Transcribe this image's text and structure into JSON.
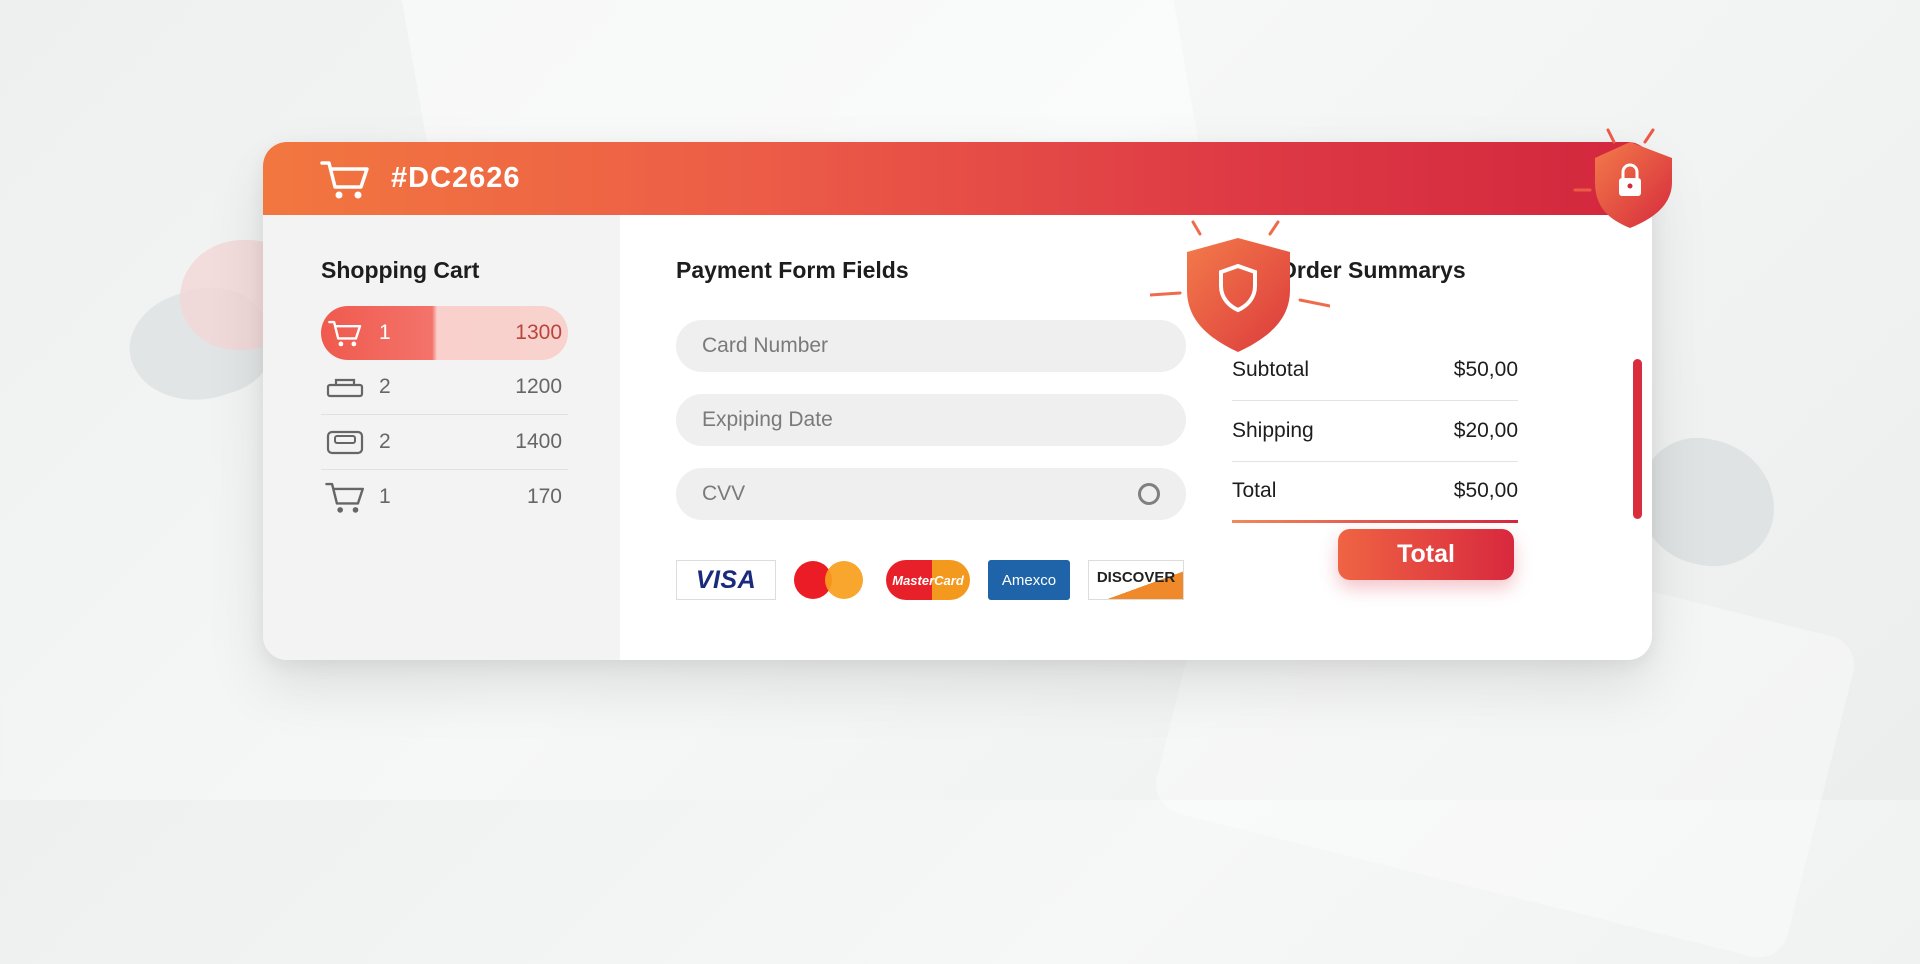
{
  "header": {
    "title": "#DC2626"
  },
  "cart": {
    "title": "Shopping Cart",
    "items": [
      {
        "icon": "cart-icon",
        "qty": "1",
        "price": "1300",
        "active": true
      },
      {
        "icon": "tray-icon",
        "qty": "2",
        "price": "1200"
      },
      {
        "icon": "box-icon",
        "qty": "2",
        "price": "1400"
      },
      {
        "icon": "cart-icon",
        "qty": "1",
        "price": "170"
      }
    ]
  },
  "payment": {
    "title": "Payment Form Fields",
    "fields": {
      "card_number_placeholder": "Card Number",
      "expiry_placeholder": "Expiping Date",
      "cvv_placeholder": "CVV"
    },
    "cards": [
      "VISA",
      "MasterCard",
      "Amexco",
      "DISCOVER"
    ]
  },
  "summary": {
    "title": "Order Summarys",
    "rows": [
      {
        "label": "Subtotal",
        "value": "$50,00"
      },
      {
        "label": "Shipping",
        "value": "$20,00"
      },
      {
        "label": "Total",
        "value": "$50,00"
      }
    ],
    "button_label": "Total"
  },
  "colors": {
    "accent_red": "#DC2626",
    "header_start": "#F2773F",
    "header_end": "#D2263D"
  }
}
